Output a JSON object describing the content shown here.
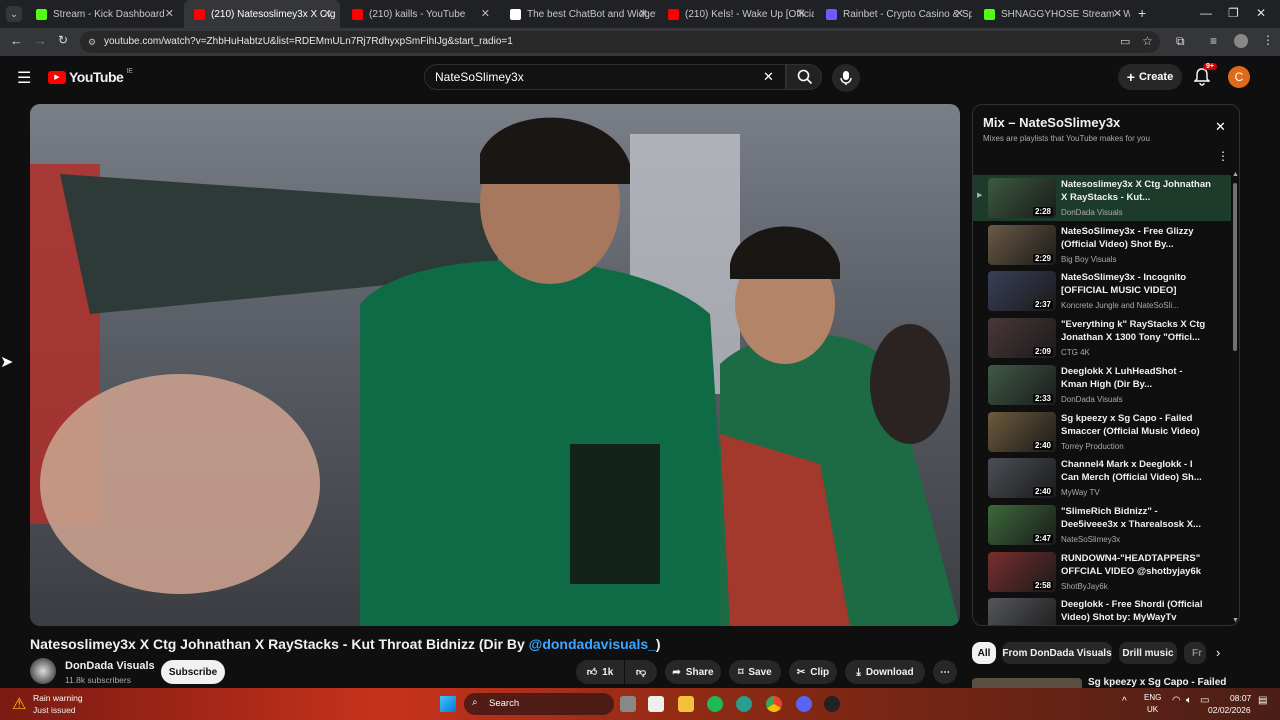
{
  "browser": {
    "tabs": [
      {
        "title": "Stream - Kick Dashboard",
        "favicon_color": "#53fc18"
      },
      {
        "title": "(210) Natesoslimey3x X Ctg",
        "favicon_color": "#ff0000",
        "active": true
      },
      {
        "title": "(210) kaills - YouTube",
        "favicon_color": "#ff0000"
      },
      {
        "title": "The best ChatBot and Widgets",
        "favicon_color": "#ffffff"
      },
      {
        "title": "(210) Kels! - Wake Up [Official V",
        "favicon_color": "#ff0000"
      },
      {
        "title": "Rainbet - Crypto Casino & Spo",
        "favicon_color": "#6a5cff"
      },
      {
        "title": "SHNAGGYHOSE Stream - Watc",
        "favicon_color": "#53fc18"
      }
    ],
    "new_tab_label": "+",
    "url": "youtube.com/watch?v=ZhbHuHabtzU&list=RDEMmULn7Rj7RdhyxpSmFihIJg&start_radio=1"
  },
  "youtube": {
    "logo_text": "YouTube",
    "logo_region": "IE",
    "search_value": "NateSoSlimey3x",
    "create_label": "Create",
    "notif_badge": "9+",
    "avatar_letter": "C"
  },
  "video": {
    "title": "Natesoslimey3x X Ctg Johnathan X RayStacks - Kut Throat Bidnizz (Dir By ",
    "title_link": "@dondadavisuals_",
    "title_suffix": ")",
    "channel_name": "DonDada Visuals",
    "subscribers": "11.8k subscribers",
    "subscribe_label": "Subscribe",
    "likes": "1k",
    "share_label": "Share",
    "save_label": "Save",
    "clip_label": "Clip",
    "download_label": "Download"
  },
  "mix": {
    "title": "Mix – NateSoSlimey3x",
    "subtitle": "Mixes are playlists that YouTube makes for you",
    "items": [
      {
        "title": "Natesoslimey3x X Ctg Johnathan X RayStacks - Kut...",
        "channel": "DonDada Visuals",
        "duration": "2:28",
        "thumb": "#3c5a40"
      },
      {
        "title": "NateSoSlimey3x - Free Glizzy (Official Video) Shot By...",
        "channel": "Big Boy Visuals",
        "duration": "2:29",
        "thumb": "#6b5a44"
      },
      {
        "title": "NateSoSlimey3x - Incognito [OFFICIAL MUSIC VIDEO]",
        "channel": "Koncrete Jungle and NateSoSli...",
        "duration": "2:37",
        "thumb": "#3a3f58"
      },
      {
        "title": "\"Everything k\" RayStacks X Ctg Jonathan X 1300 Tony \"Offici...",
        "channel": "CTG 4K",
        "duration": "2:09",
        "thumb": "#4a3838"
      },
      {
        "title": "Deeglokk X LuhHeadShot - Kman High (Dir By...",
        "channel": "DonDada Visuals",
        "duration": "2:33",
        "thumb": "#3f5a48"
      },
      {
        "title": "Sg kpeezy x Sg Capo - Failed Smaccer (Official Music Video)",
        "channel": "Torrey Production",
        "duration": "2:40",
        "thumb": "#6e5a3c"
      },
      {
        "title": "Channel4 Mark x Deeglokk - I Can Merch (Official Video) Sh...",
        "channel": "MyWay TV",
        "duration": "2:40",
        "thumb": "#4b4f55"
      },
      {
        "title": "\"SlimeRich Bidnizz\" - Dee5iveee3x x Tharealsosk X...",
        "channel": "NateSoSlimey3x",
        "duration": "2:47",
        "thumb": "#3d6a3a"
      },
      {
        "title": "RUNDOWN4-\"HEADTAPPERS\" OFFCIAL VIDEO @shotbyjay6k",
        "channel": "ShotByJay6k",
        "duration": "2:58",
        "thumb": "#7a2e2e"
      },
      {
        "title": "Deeglokk - Free Shordi (Official Video) Shot by: MyWayTv",
        "channel": "",
        "duration": "2:09",
        "thumb": "#55575c"
      }
    ]
  },
  "chips": [
    {
      "label": "All",
      "active": true
    },
    {
      "label": "From DonDada Visuals"
    },
    {
      "label": "Drill music"
    },
    {
      "label": "Fr"
    }
  ],
  "next_preview": {
    "title": "Sg kpeezy x Sg Capo - Failed"
  },
  "taskbar": {
    "weather_title": "Rain warning",
    "weather_sub": "Just issued",
    "search_label": "Search",
    "lang": "ENG",
    "region": "UK",
    "time": "08:07",
    "date": "02/02/2026"
  }
}
